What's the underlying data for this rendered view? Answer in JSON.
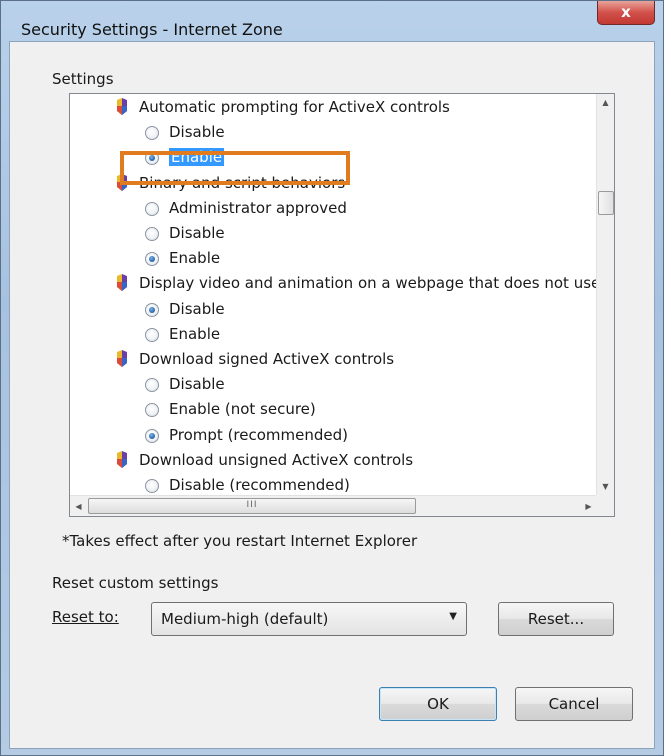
{
  "window": {
    "title": "Security Settings - Internet Zone",
    "close_label": "x"
  },
  "settings": {
    "label": "Settings",
    "items": [
      {
        "type": "category",
        "label": "Automatic prompting for ActiveX controls"
      },
      {
        "type": "option",
        "label": "Disable",
        "checked": false
      },
      {
        "type": "option",
        "label": "Enable",
        "checked": true,
        "selected": true
      },
      {
        "type": "category",
        "label": "Binary and script behaviors"
      },
      {
        "type": "option",
        "label": "Administrator approved",
        "checked": false
      },
      {
        "type": "option",
        "label": "Disable",
        "checked": false
      },
      {
        "type": "option",
        "label": "Enable",
        "checked": true
      },
      {
        "type": "category",
        "label": "Display video and animation on a webpage that does not use"
      },
      {
        "type": "option",
        "label": "Disable",
        "checked": true
      },
      {
        "type": "option",
        "label": "Enable",
        "checked": false
      },
      {
        "type": "category",
        "label": "Download signed ActiveX controls"
      },
      {
        "type": "option",
        "label": "Disable",
        "checked": false
      },
      {
        "type": "option",
        "label": "Enable (not secure)",
        "checked": false
      },
      {
        "type": "option",
        "label": "Prompt (recommended)",
        "checked": true
      },
      {
        "type": "category",
        "label": "Download unsigned ActiveX controls"
      },
      {
        "type": "option",
        "label": "Disable (recommended)",
        "checked": false
      }
    ],
    "hscroll_grip": "III"
  },
  "note": "*Takes effect after you restart Internet Explorer",
  "reset": {
    "section_label": "Reset custom settings",
    "reset_to_label": "Reset to:",
    "selected_level": "Medium-high (default)",
    "reset_button": "Reset..."
  },
  "buttons": {
    "ok": "OK",
    "cancel": "Cancel"
  },
  "colors": {
    "highlight_border": "#e07b1f",
    "selection": "#3399ff"
  },
  "icons": {
    "category": "shield-icon",
    "option": "radio-button"
  }
}
